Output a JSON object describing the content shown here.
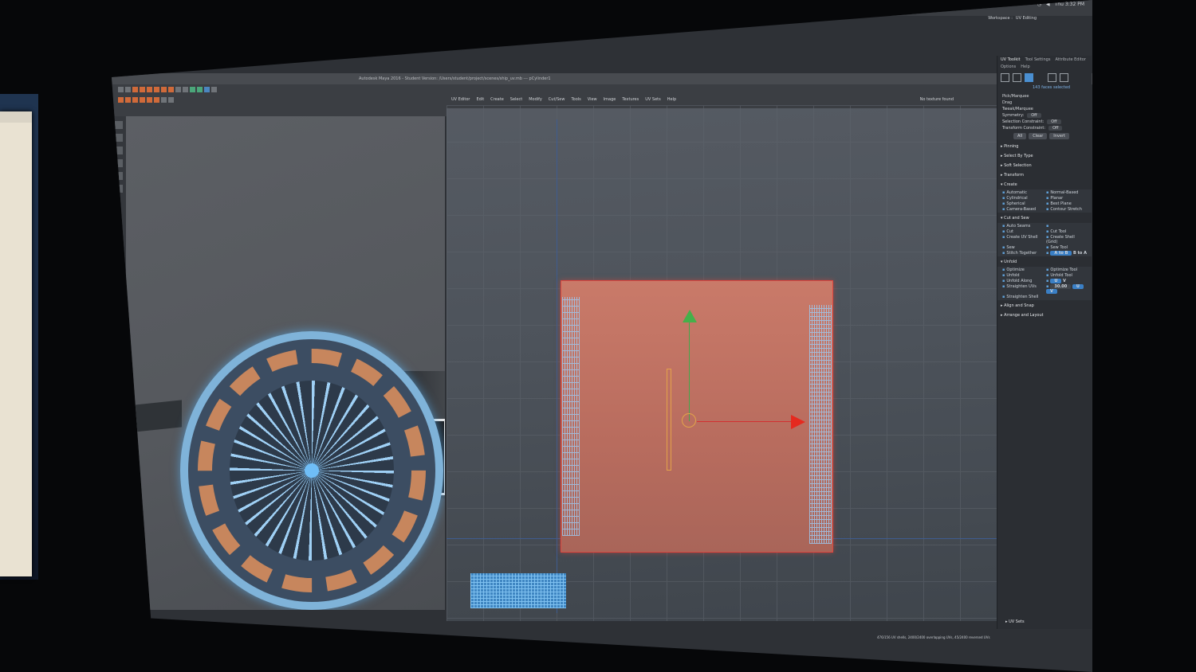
{
  "app": {
    "workspace_label": "Workspace :",
    "workspace_value": "UV Editing",
    "titlebar_text": "Autodesk Maya 2016 - Student Version: /Users/student/project/scenes/ship_uv.mb --- pCylinder1",
    "system_time": "Thu 3:32 PM"
  },
  "uv_editor": {
    "title": "UV Editor",
    "menu": [
      "Edit",
      "Create",
      "Select",
      "Modify",
      "Cut/Sew",
      "Tools",
      "View",
      "Image",
      "Textures",
      "UV Sets",
      "Help"
    ],
    "texture_dropdown": "No texture found"
  },
  "uv_toolkit": {
    "tabs": [
      "UV Toolkit",
      "Tool Settings",
      "Attribute Editor"
    ],
    "sub_menu": [
      "Options",
      "Help"
    ],
    "selection_status": "143 faces selected",
    "pick_modes": [
      "Pick/Marquee",
      "Drag",
      "Tweak/Marquee"
    ],
    "symmetry_label": "Symmetry:",
    "symmetry_value": "Off",
    "selection_constraint_label": "Selection Constraint:",
    "selection_constraint_value": "Off",
    "transform_constraint_label": "Transform Constraint:",
    "transform_constraint_value": "Off",
    "select_buttons": [
      "All",
      "Clear",
      "Invert"
    ],
    "sections": {
      "pinning": "Pinning",
      "select_by_type": "Select By Type",
      "soft_selection": "Soft Selection",
      "transform": "Transform",
      "create": "Create",
      "cut_and_sew": "Cut and Sew",
      "unfold": "Unfold",
      "align_and_snap": "Align and Snap",
      "arrange_and_layout": "Arrange and Layout",
      "uv_sets": "UV Sets"
    },
    "create_items": [
      "Automatic",
      "Normal-Based",
      "Cylindrical",
      "Planar",
      "Spherical",
      "Best Plane",
      "Camera-Based",
      "Contour Stretch"
    ],
    "cut_items": [
      "Auto Seams",
      "Cut",
      "Cut Tool",
      "Create UV Shell",
      "Create Shell (Grid)",
      "Sew",
      "Sew Tool",
      "Stitch Together"
    ],
    "stitch_options": [
      "A to B",
      "B to A"
    ],
    "unfold_items": [
      "Optimize",
      "Optimize Tool",
      "Unfold",
      "Unfold Tool"
    ],
    "unfold_along_label": "Unfold Along",
    "unfold_along_options": [
      "U",
      "V"
    ],
    "straighten_uvs_label": "Straighten UVs",
    "straighten_uvs_value": "30.00",
    "straighten_uvs_options": [
      "U",
      "V"
    ],
    "straighten_shell_label": "Straighten Shell"
  },
  "status_bar": {
    "text": "476/156 UV shells, 2400/2400 overlapping UVs, 45/2400 reversed UVs"
  },
  "colors": {
    "accent_blue": "#4a8fd1",
    "shell_fill": "#c97a69",
    "shell_border": "#e0453c",
    "gizmo_y": "#45b04a",
    "gizmo_x": "#e52a1f",
    "gizmo_center": "#e2a44a"
  },
  "icons": [
    "checkerboard-icon",
    "shell-icon",
    "uv-icon",
    "face-icon",
    "vertex-icon"
  ]
}
